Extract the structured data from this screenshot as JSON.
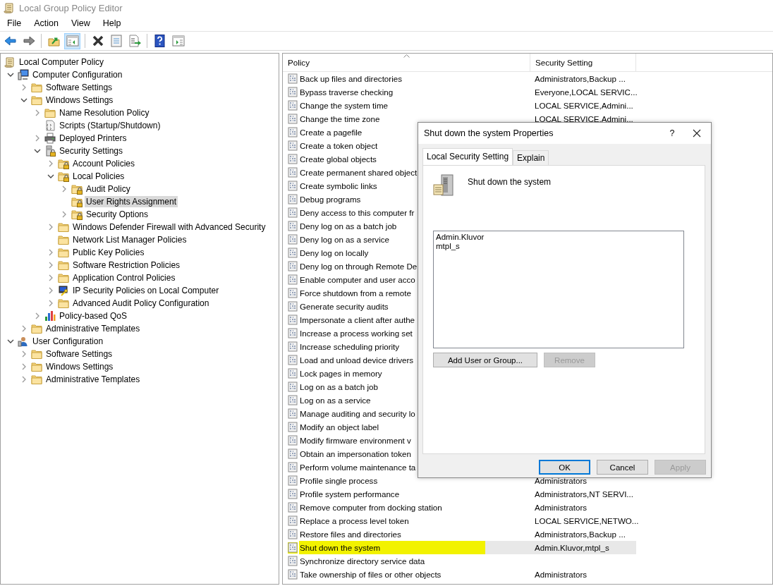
{
  "window": {
    "title": "Local Group Policy Editor"
  },
  "menu": [
    "File",
    "Action",
    "View",
    "Help"
  ],
  "toolbar": [
    {
      "kind": "back",
      "pressed": false
    },
    {
      "kind": "forward",
      "pressed": false
    },
    {
      "kind": "separator"
    },
    {
      "kind": "up",
      "pressed": false
    },
    {
      "kind": "tree",
      "pressed": true
    },
    {
      "kind": "separator"
    },
    {
      "kind": "delete",
      "pressed": false
    },
    {
      "kind": "properties",
      "pressed": false
    },
    {
      "kind": "export",
      "pressed": false
    },
    {
      "kind": "separator"
    },
    {
      "kind": "help",
      "pressed": false
    },
    {
      "kind": "actionpane",
      "pressed": false
    }
  ],
  "tree": [
    {
      "label": "Local Computer Policy",
      "kind": "scroll",
      "selected": false,
      "children": [
        {
          "label": "Computer Configuration",
          "kind": "computer",
          "expanded": true,
          "selected": false,
          "children": [
            {
              "label": "Software Settings",
              "kind": "folder",
              "expanded": false,
              "selected": false
            },
            {
              "label": "Windows Settings",
              "kind": "folder",
              "expanded": true,
              "selected": false,
              "children": [
                {
                  "label": "Name Resolution Policy",
                  "kind": "folder",
                  "expanded": false,
                  "selected": false
                },
                {
                  "label": "Scripts (Startup/Shutdown)",
                  "kind": "script",
                  "selected": false
                },
                {
                  "label": "Deployed Printers",
                  "kind": "printer",
                  "expanded": false,
                  "selected": false
                },
                {
                  "label": "Security Settings",
                  "kind": "security",
                  "expanded": true,
                  "selected": false,
                  "children": [
                    {
                      "label": "Account Policies",
                      "kind": "lockfolder",
                      "expanded": false,
                      "selected": false
                    },
                    {
                      "label": "Local Policies",
                      "kind": "lockfolder",
                      "expanded": true,
                      "selected": false,
                      "children": [
                        {
                          "label": "Audit Policy",
                          "kind": "lockfolder",
                          "expanded": false,
                          "selected": false
                        },
                        {
                          "label": "User Rights Assignment",
                          "kind": "lockfolder",
                          "selected": true
                        },
                        {
                          "label": "Security Options",
                          "kind": "lockfolder",
                          "expanded": false,
                          "selected": false
                        }
                      ]
                    },
                    {
                      "label": "Windows Defender Firewall with Advanced Security",
                      "kind": "folder",
                      "expanded": false,
                      "selected": false
                    },
                    {
                      "label": "Network List Manager Policies",
                      "kind": "folder",
                      "selected": false
                    },
                    {
                      "label": "Public Key Policies",
                      "kind": "folder",
                      "expanded": false,
                      "selected": false
                    },
                    {
                      "label": "Software Restriction Policies",
                      "kind": "folder",
                      "expanded": false,
                      "selected": false
                    },
                    {
                      "label": "Application Control Policies",
                      "kind": "folder",
                      "expanded": false,
                      "selected": false
                    },
                    {
                      "label": "IP Security Policies on Local Computer",
                      "kind": "ip",
                      "expanded": false,
                      "selected": false
                    },
                    {
                      "label": "Advanced Audit Policy Configuration",
                      "kind": "folder",
                      "expanded": false,
                      "selected": false
                    }
                  ]
                },
                {
                  "label": "Policy-based QoS",
                  "kind": "chart",
                  "expanded": false,
                  "selected": false
                }
              ]
            },
            {
              "label": "Administrative Templates",
              "kind": "folder",
              "expanded": false,
              "selected": false
            }
          ]
        },
        {
          "label": "User Configuration",
          "kind": "user",
          "expanded": true,
          "selected": false,
          "children": [
            {
              "label": "Software Settings",
              "kind": "folder",
              "expanded": false,
              "selected": false
            },
            {
              "label": "Windows Settings",
              "kind": "folder",
              "expanded": false,
              "selected": false
            },
            {
              "label": "Administrative Templates",
              "kind": "folder",
              "expanded": false,
              "selected": false
            }
          ]
        }
      ]
    }
  ],
  "table": {
    "columns": [
      {
        "label": "Policy",
        "sorted": true
      },
      {
        "label": "Security Setting",
        "sorted": false
      }
    ],
    "rows": [
      {
        "policy": "Back up files and directories",
        "setting": "Administrators,Backup ...",
        "selected": false,
        "highlighted": false
      },
      {
        "policy": "Bypass traverse checking",
        "setting": "Everyone,LOCAL SERVIC...",
        "selected": false,
        "highlighted": false
      },
      {
        "policy": "Change the system time",
        "setting": "LOCAL SERVICE,Admini...",
        "selected": false,
        "highlighted": false
      },
      {
        "policy": "Change the time zone",
        "setting": "LOCAL SERVICE,Admini...",
        "selected": false,
        "highlighted": false
      },
      {
        "policy": "Create a pagefile",
        "selected": false,
        "highlighted": false
      },
      {
        "policy": "Create a token object",
        "selected": false,
        "highlighted": false
      },
      {
        "policy": "Create global objects",
        "selected": false,
        "highlighted": false
      },
      {
        "policy": "Create permanent shared object",
        "selected": false,
        "highlighted": false
      },
      {
        "policy": "Create symbolic links",
        "selected": false,
        "highlighted": false
      },
      {
        "policy": "Debug programs",
        "selected": false,
        "highlighted": false
      },
      {
        "policy": "Deny access to this computer fr",
        "selected": false,
        "highlighted": false
      },
      {
        "policy": "Deny log on as a batch job",
        "selected": false,
        "highlighted": false
      },
      {
        "policy": "Deny log on as a service",
        "selected": false,
        "highlighted": false
      },
      {
        "policy": "Deny log on locally",
        "selected": false,
        "highlighted": false
      },
      {
        "policy": "Deny log on through Remote De",
        "selected": false,
        "highlighted": false
      },
      {
        "policy": "Enable computer and user acco",
        "selected": false,
        "highlighted": false
      },
      {
        "policy": "Force shutdown from a remote",
        "selected": false,
        "highlighted": false
      },
      {
        "policy": "Generate security audits",
        "selected": false,
        "highlighted": false
      },
      {
        "policy": "Impersonate a client after authe",
        "selected": false,
        "highlighted": false
      },
      {
        "policy": "Increase a process working set",
        "selected": false,
        "highlighted": false
      },
      {
        "policy": "Increase scheduling priority",
        "selected": false,
        "highlighted": false
      },
      {
        "policy": "Load and unload device drivers",
        "selected": false,
        "highlighted": false
      },
      {
        "policy": "Lock pages in memory",
        "selected": false,
        "highlighted": false
      },
      {
        "policy": "Log on as a batch job",
        "selected": false,
        "highlighted": false
      },
      {
        "policy": "Log on as a service",
        "selected": false,
        "highlighted": false
      },
      {
        "policy": "Manage auditing and security lo",
        "selected": false,
        "highlighted": false
      },
      {
        "policy": "Modify an object label",
        "selected": false,
        "highlighted": false
      },
      {
        "policy": "Modify firmware environment v",
        "selected": false,
        "highlighted": false
      },
      {
        "policy": "Obtain an impersonation token",
        "selected": false,
        "highlighted": false
      },
      {
        "policy": "Perform volume maintenance ta",
        "selected": false,
        "highlighted": false
      },
      {
        "policy": "Profile single process",
        "setting": "Administrators",
        "selected": false,
        "highlighted": false
      },
      {
        "policy": "Profile system performance",
        "setting": "Administrators,NT SERVI...",
        "selected": false,
        "highlighted": false
      },
      {
        "policy": "Remove computer from docking station",
        "setting": "Administrators",
        "selected": false,
        "highlighted": false
      },
      {
        "policy": "Replace a process level token",
        "setting": "LOCAL SERVICE,NETWO...",
        "selected": false,
        "highlighted": false
      },
      {
        "policy": "Restore files and directories",
        "setting": "Administrators,Backup ...",
        "selected": false,
        "highlighted": false
      },
      {
        "policy": "Shut down the system",
        "setting": "Admin.Kluvor,mtpl_s",
        "selected": true,
        "highlighted": true
      },
      {
        "policy": "Synchronize directory service data",
        "selected": false,
        "highlighted": false
      },
      {
        "policy": "Take ownership of files or other objects",
        "setting": "Administrators",
        "selected": false,
        "highlighted": false
      }
    ]
  },
  "dialog": {
    "title": "Shut down the system Properties",
    "help_button": "?",
    "tabs": [
      {
        "label": "Local Security Setting",
        "selected": true
      },
      {
        "label": "Explain",
        "selected": false
      }
    ],
    "policy_title": "Shut down the system",
    "members": [
      "Admin.Kluvor",
      "mtpl_s"
    ],
    "buttons": [
      {
        "label": "Add User or Group...",
        "disabled": false
      },
      {
        "label": "Remove",
        "disabled": true
      }
    ],
    "footer_buttons": [
      {
        "label": "OK",
        "default": true,
        "disabled": false
      },
      {
        "label": "Cancel",
        "default": false,
        "disabled": false
      },
      {
        "label": "Apply",
        "default": false,
        "disabled": true
      }
    ]
  }
}
